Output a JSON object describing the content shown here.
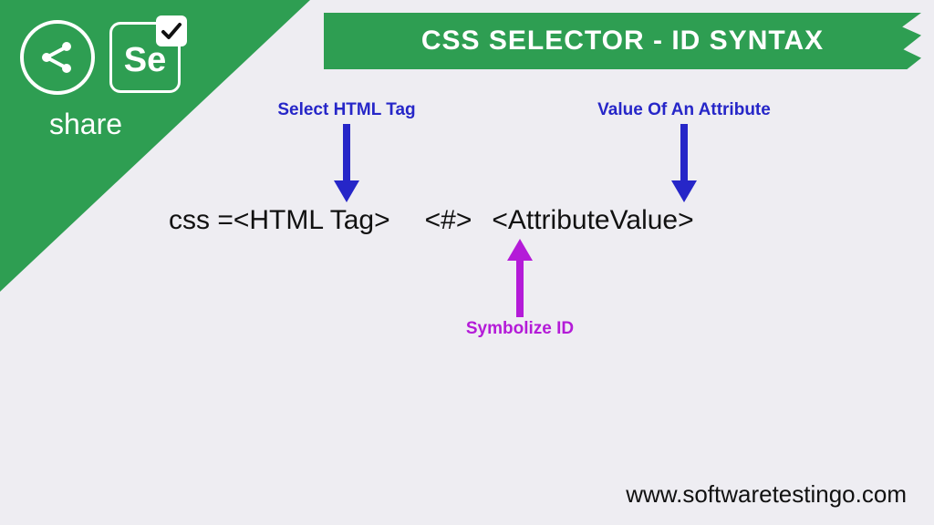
{
  "header": {
    "share_label": "share",
    "se_label": "Se",
    "title": "CSS SELECTOR - ID SYNTAX"
  },
  "syntax": {
    "prefix": "css = ",
    "html_tag": "<HTML Tag>",
    "hash": "<#>",
    "attr_value": "<AttributeValue>"
  },
  "annotations": {
    "select_tag": "Select HTML Tag",
    "value_attr": "Value Of An Attribute",
    "symbolize_id": "Symbolize ID"
  },
  "footer": {
    "url": "www.softwaretestingo.com"
  }
}
